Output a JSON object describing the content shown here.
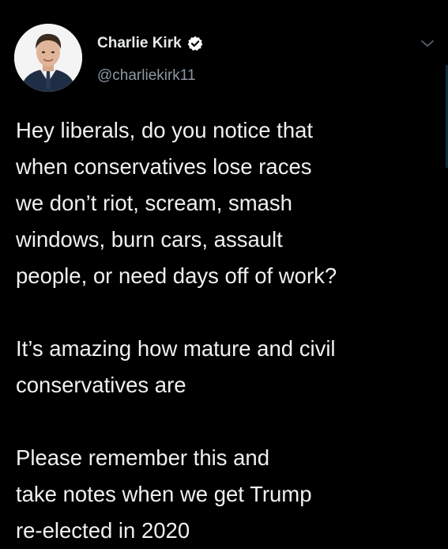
{
  "author": {
    "name": "Charlie Kirk",
    "handle": "@charliekirk11",
    "verified": true,
    "avatar_icon": "profile-photo"
  },
  "menu": {
    "icon": "chevron-down-icon"
  },
  "tweet": {
    "paragraphs": [
      {
        "lines": [
          "Hey liberals, do you notice that",
          "when conservatives lose races",
          "we don’t riot, scream, smash",
          "windows, burn cars, assault",
          "people, or need days off of work?"
        ]
      },
      {
        "lines": [
          "It’s amazing how mature and civil",
          "conservatives are"
        ]
      },
      {
        "lines": [
          "Please remember this and",
          "take notes when we get Trump",
          "re-elected in 2020"
        ]
      }
    ]
  },
  "colors": {
    "background": "#000000",
    "text": "#eef0f2",
    "secondary_text": "#8b98a5",
    "verified_badge": "#ffffff"
  }
}
